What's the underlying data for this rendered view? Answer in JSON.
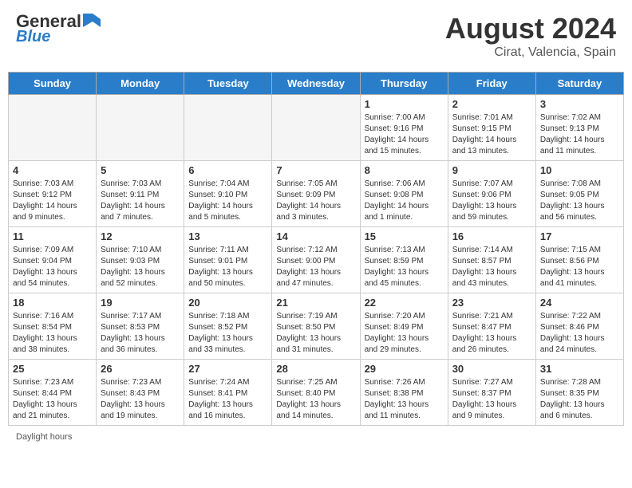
{
  "header": {
    "logo_line1": "General",
    "logo_line2": "Blue",
    "main_title": "August 2024",
    "subtitle": "Cirat, Valencia, Spain"
  },
  "columns": [
    "Sunday",
    "Monday",
    "Tuesday",
    "Wednesday",
    "Thursday",
    "Friday",
    "Saturday"
  ],
  "weeks": [
    [
      {
        "day": "",
        "info": ""
      },
      {
        "day": "",
        "info": ""
      },
      {
        "day": "",
        "info": ""
      },
      {
        "day": "",
        "info": ""
      },
      {
        "day": "1",
        "info": "Sunrise: 7:00 AM\nSunset: 9:16 PM\nDaylight: 14 hours\nand 15 minutes."
      },
      {
        "day": "2",
        "info": "Sunrise: 7:01 AM\nSunset: 9:15 PM\nDaylight: 14 hours\nand 13 minutes."
      },
      {
        "day": "3",
        "info": "Sunrise: 7:02 AM\nSunset: 9:13 PM\nDaylight: 14 hours\nand 11 minutes."
      }
    ],
    [
      {
        "day": "4",
        "info": "Sunrise: 7:03 AM\nSunset: 9:12 PM\nDaylight: 14 hours\nand 9 minutes."
      },
      {
        "day": "5",
        "info": "Sunrise: 7:03 AM\nSunset: 9:11 PM\nDaylight: 14 hours\nand 7 minutes."
      },
      {
        "day": "6",
        "info": "Sunrise: 7:04 AM\nSunset: 9:10 PM\nDaylight: 14 hours\nand 5 minutes."
      },
      {
        "day": "7",
        "info": "Sunrise: 7:05 AM\nSunset: 9:09 PM\nDaylight: 14 hours\nand 3 minutes."
      },
      {
        "day": "8",
        "info": "Sunrise: 7:06 AM\nSunset: 9:08 PM\nDaylight: 14 hours\nand 1 minute."
      },
      {
        "day": "9",
        "info": "Sunrise: 7:07 AM\nSunset: 9:06 PM\nDaylight: 13 hours\nand 59 minutes."
      },
      {
        "day": "10",
        "info": "Sunrise: 7:08 AM\nSunset: 9:05 PM\nDaylight: 13 hours\nand 56 minutes."
      }
    ],
    [
      {
        "day": "11",
        "info": "Sunrise: 7:09 AM\nSunset: 9:04 PM\nDaylight: 13 hours\nand 54 minutes."
      },
      {
        "day": "12",
        "info": "Sunrise: 7:10 AM\nSunset: 9:03 PM\nDaylight: 13 hours\nand 52 minutes."
      },
      {
        "day": "13",
        "info": "Sunrise: 7:11 AM\nSunset: 9:01 PM\nDaylight: 13 hours\nand 50 minutes."
      },
      {
        "day": "14",
        "info": "Sunrise: 7:12 AM\nSunset: 9:00 PM\nDaylight: 13 hours\nand 47 minutes."
      },
      {
        "day": "15",
        "info": "Sunrise: 7:13 AM\nSunset: 8:59 PM\nDaylight: 13 hours\nand 45 minutes."
      },
      {
        "day": "16",
        "info": "Sunrise: 7:14 AM\nSunset: 8:57 PM\nDaylight: 13 hours\nand 43 minutes."
      },
      {
        "day": "17",
        "info": "Sunrise: 7:15 AM\nSunset: 8:56 PM\nDaylight: 13 hours\nand 41 minutes."
      }
    ],
    [
      {
        "day": "18",
        "info": "Sunrise: 7:16 AM\nSunset: 8:54 PM\nDaylight: 13 hours\nand 38 minutes."
      },
      {
        "day": "19",
        "info": "Sunrise: 7:17 AM\nSunset: 8:53 PM\nDaylight: 13 hours\nand 36 minutes."
      },
      {
        "day": "20",
        "info": "Sunrise: 7:18 AM\nSunset: 8:52 PM\nDaylight: 13 hours\nand 33 minutes."
      },
      {
        "day": "21",
        "info": "Sunrise: 7:19 AM\nSunset: 8:50 PM\nDaylight: 13 hours\nand 31 minutes."
      },
      {
        "day": "22",
        "info": "Sunrise: 7:20 AM\nSunset: 8:49 PM\nDaylight: 13 hours\nand 29 minutes."
      },
      {
        "day": "23",
        "info": "Sunrise: 7:21 AM\nSunset: 8:47 PM\nDaylight: 13 hours\nand 26 minutes."
      },
      {
        "day": "24",
        "info": "Sunrise: 7:22 AM\nSunset: 8:46 PM\nDaylight: 13 hours\nand 24 minutes."
      }
    ],
    [
      {
        "day": "25",
        "info": "Sunrise: 7:23 AM\nSunset: 8:44 PM\nDaylight: 13 hours\nand 21 minutes."
      },
      {
        "day": "26",
        "info": "Sunrise: 7:23 AM\nSunset: 8:43 PM\nDaylight: 13 hours\nand 19 minutes."
      },
      {
        "day": "27",
        "info": "Sunrise: 7:24 AM\nSunset: 8:41 PM\nDaylight: 13 hours\nand 16 minutes."
      },
      {
        "day": "28",
        "info": "Sunrise: 7:25 AM\nSunset: 8:40 PM\nDaylight: 13 hours\nand 14 minutes."
      },
      {
        "day": "29",
        "info": "Sunrise: 7:26 AM\nSunset: 8:38 PM\nDaylight: 13 hours\nand 11 minutes."
      },
      {
        "day": "30",
        "info": "Sunrise: 7:27 AM\nSunset: 8:37 PM\nDaylight: 13 hours\nand 9 minutes."
      },
      {
        "day": "31",
        "info": "Sunrise: 7:28 AM\nSunset: 8:35 PM\nDaylight: 13 hours\nand 6 minutes."
      }
    ]
  ],
  "legend": {
    "label": "Daylight hours"
  }
}
